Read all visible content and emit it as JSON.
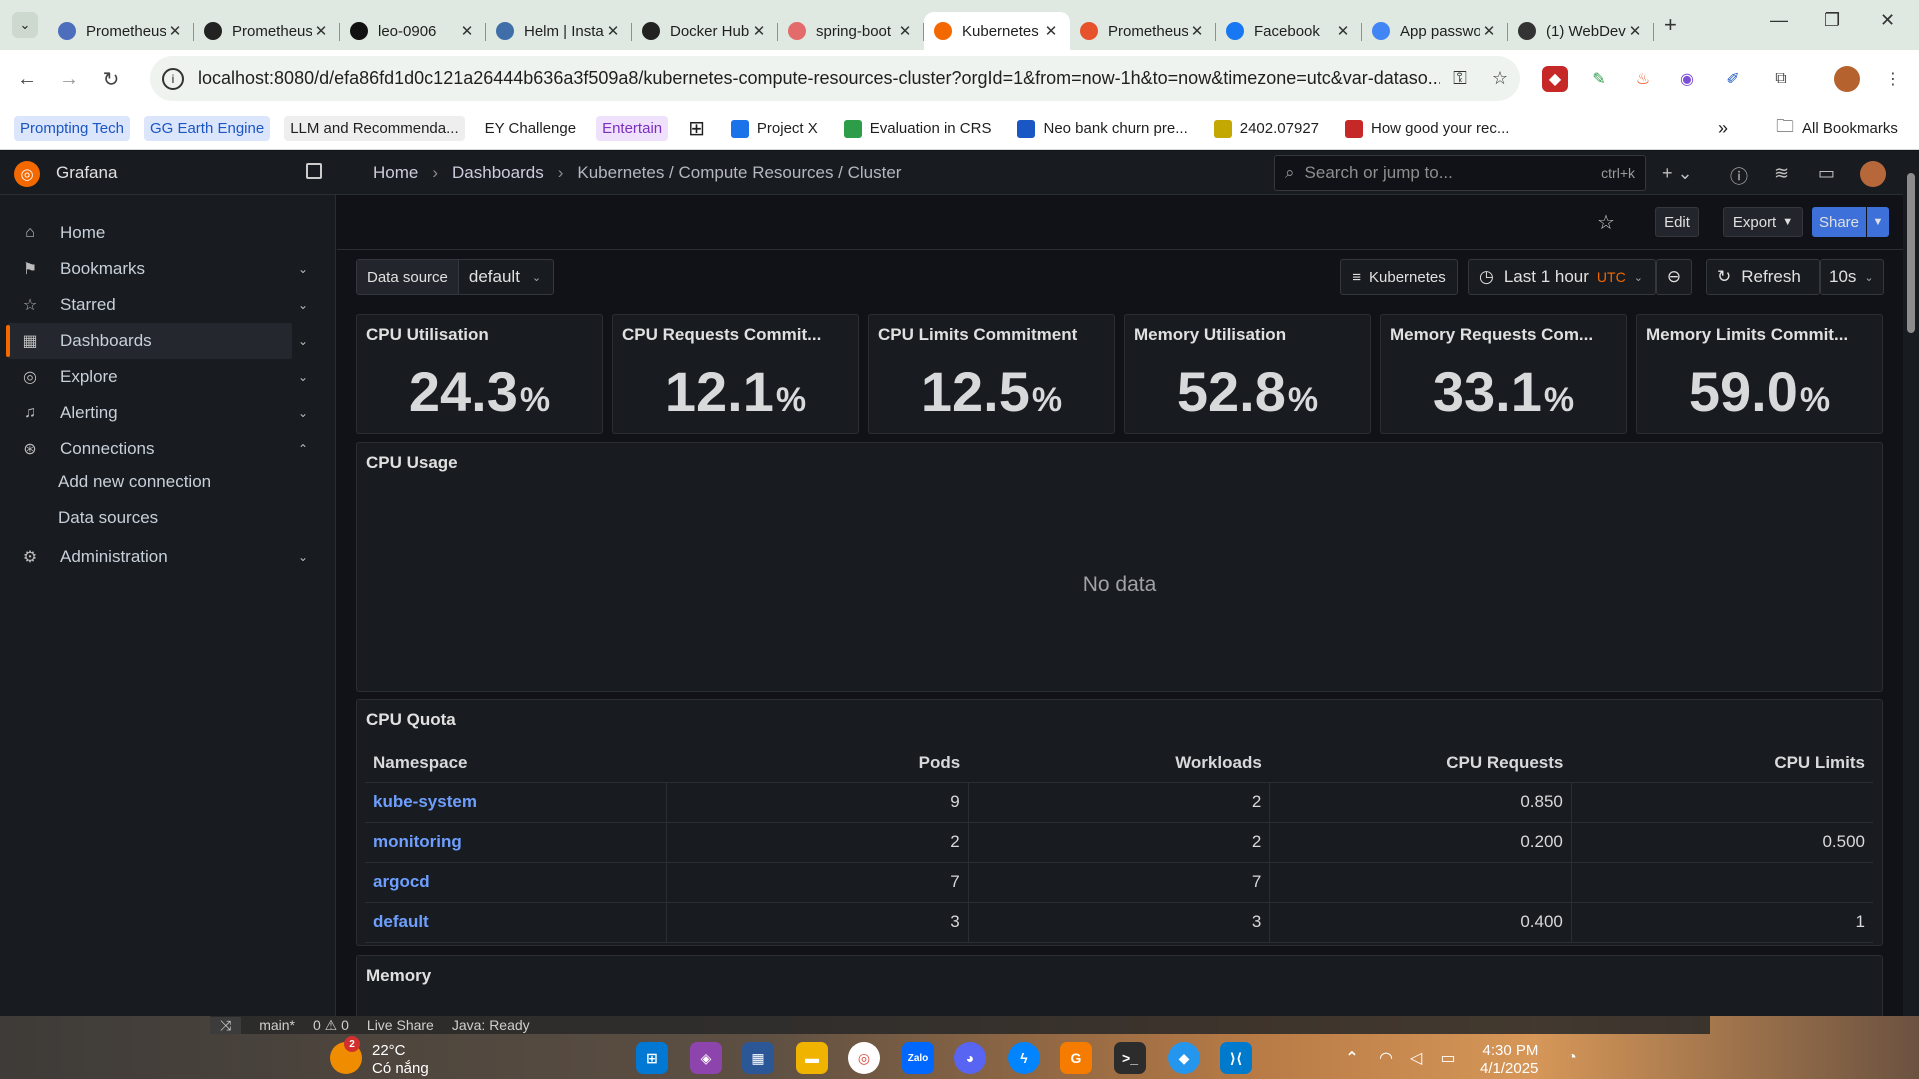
{
  "browser": {
    "tabs": [
      {
        "title": "Prometheus",
        "favicon_color": "#4d6dbd"
      },
      {
        "title": "Prometheus",
        "favicon_color": "#222222"
      },
      {
        "title": "leo-0906",
        "favicon_color": "#111111"
      },
      {
        "title": "Helm | Installing",
        "favicon_color": "#3f6ea8"
      },
      {
        "title": "Docker Hub",
        "favicon_color": "#222222"
      },
      {
        "title": "spring-boot",
        "favicon_color": "#e46b6b"
      },
      {
        "title": "Kubernetes",
        "favicon_color": "#f46800",
        "active": true
      },
      {
        "title": "Prometheus",
        "favicon_color": "#e6522c"
      },
      {
        "title": "Facebook",
        "favicon_color": "#1877f2"
      },
      {
        "title": "App passwords",
        "favicon_color": "#4285f4"
      },
      {
        "title": "(1) WebDev",
        "favicon_color": "#333333"
      }
    ],
    "new_tab_label": "+",
    "url": "localhost:8080/d/efa86fd1d0c121a26444b636a3f509a8/kubernetes-compute-resources-cluster?orgId=1&from=now-1h&to=now&timezone=utc&var-dataso...",
    "bookmarks": [
      {
        "label": "Prompting Tech",
        "style": "blue-chip"
      },
      {
        "label": "GG Earth Engine",
        "style": "blue-chip"
      },
      {
        "label": "LLM and Recommenda...",
        "style": "gray-chip"
      },
      {
        "label": "EY Challenge",
        "style": "plain"
      },
      {
        "label": "Entertain",
        "style": "purple-chip"
      },
      {
        "label": "Project X",
        "style": "icon"
      },
      {
        "label": "Evaluation in CRS",
        "style": "icon"
      },
      {
        "label": "Neo bank churn pre...",
        "style": "icon"
      },
      {
        "label": "2402.07927",
        "style": "icon"
      },
      {
        "label": "How good your rec...",
        "style": "icon"
      }
    ],
    "all_bookmarks_label": "All Bookmarks"
  },
  "grafana": {
    "brand": "Grafana",
    "breadcrumbs": [
      "Home",
      "Dashboards",
      "Kubernetes / Compute Resources / Cluster"
    ],
    "search_placeholder": "Search or jump to...",
    "search_shortcut": "ctrl+k",
    "nav": [
      {
        "label": "Home",
        "icon": "home-icon",
        "chevron": ""
      },
      {
        "label": "Bookmarks",
        "icon": "bookmark-icon",
        "chevron": "⌄"
      },
      {
        "label": "Starred",
        "icon": "star-icon",
        "chevron": "⌄"
      },
      {
        "label": "Dashboards",
        "icon": "dashboards-icon",
        "chevron": "⌄",
        "active": true
      },
      {
        "label": "Explore",
        "icon": "compass-icon",
        "chevron": "⌄"
      },
      {
        "label": "Alerting",
        "icon": "bell-icon",
        "chevron": "⌄"
      },
      {
        "label": "Connections",
        "icon": "connections-icon",
        "chevron": "⌃"
      },
      {
        "label": "Administration",
        "icon": "gear-icon",
        "chevron": "⌄"
      }
    ],
    "nav_sub": [
      "Add new connection",
      "Data sources"
    ],
    "toolbar": {
      "edit": "Edit",
      "export": "Export",
      "share": "Share"
    },
    "variables": {
      "datasource_label": "Data source",
      "datasource_value": "default"
    },
    "controls": {
      "kubernetes": "Kubernetes",
      "time_range": "Last 1 hour",
      "timezone": "UTC",
      "refresh": "Refresh",
      "interval": "10s"
    },
    "stats": [
      {
        "title": "CPU Utilisation",
        "value": "24.3",
        "unit": "%"
      },
      {
        "title": "CPU Requests Commit...",
        "value": "12.1",
        "unit": "%"
      },
      {
        "title": "CPU Limits Commitment",
        "value": "12.5",
        "unit": "%"
      },
      {
        "title": "Memory Utilisation",
        "value": "52.8",
        "unit": "%"
      },
      {
        "title": "Memory Requests Com...",
        "value": "33.1",
        "unit": "%"
      },
      {
        "title": "Memory Limits Commit...",
        "value": "59.0",
        "unit": "%"
      }
    ],
    "cpu_usage": {
      "title": "CPU Usage",
      "no_data": "No data"
    },
    "cpu_quota": {
      "title": "CPU Quota",
      "columns": [
        "Namespace",
        "Pods",
        "Workloads",
        "CPU Requests",
        "CPU Limits"
      ],
      "rows": [
        [
          "kube-system",
          "9",
          "2",
          "0.850",
          ""
        ],
        [
          "monitoring",
          "2",
          "2",
          "0.200",
          "0.500"
        ],
        [
          "argocd",
          "7",
          "7",
          "",
          ""
        ],
        [
          "default",
          "3",
          "3",
          "0.400",
          "1"
        ]
      ]
    },
    "memory_panel_title": "Memory"
  },
  "taskbar": {
    "vscode_status": [
      "main*",
      "0 ⚠ 0",
      "Live Share",
      "Java: Ready"
    ],
    "weather_temp": "22°C",
    "weather_desc": "Có nắng",
    "weather_badge": "2",
    "time": "4:30 PM",
    "date": "4/1/2025"
  }
}
